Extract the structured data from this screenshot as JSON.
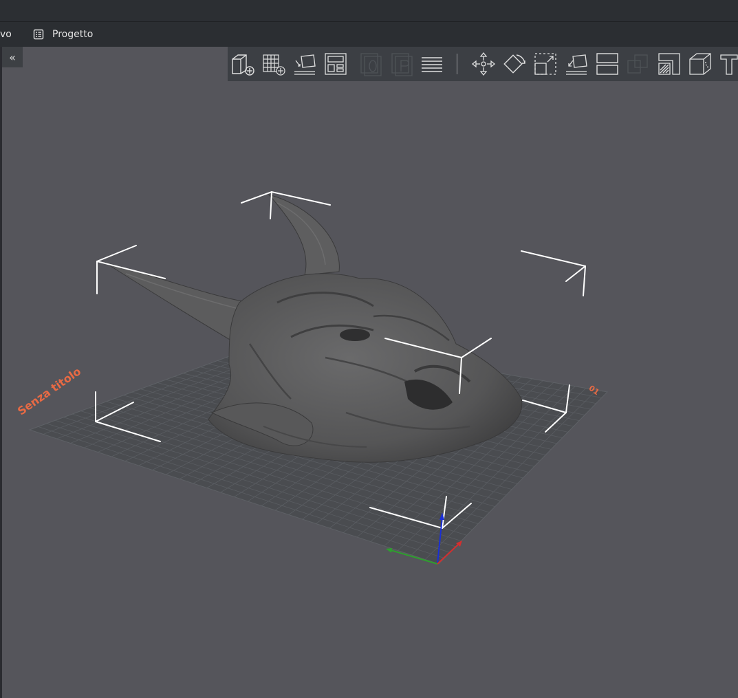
{
  "tabs": {
    "prev_label": "vo",
    "project_label": "Progetto"
  },
  "collapse_glyph": "«",
  "toolbar": {
    "buttons": [
      "add-cube-icon",
      "add-grid-icon",
      "layflat-icon",
      "layout-icon",
      "zero-icon-disabled",
      "p-icon-disabled",
      "layers-icon",
      "move-icon",
      "rotate-icon",
      "scale-icon",
      "place-face-icon",
      "split-icon",
      "merge-icon-disabled",
      "support-paint-icon",
      "seam-cube-icon",
      "text-icon"
    ]
  },
  "plate": {
    "name": "Senza titolo",
    "number": "01"
  },
  "colors": {
    "viewport_bg": "#55555b",
    "plate_label": "#e86a44",
    "axis_x": "#d32f2f",
    "axis_y": "#2e9e2e",
    "axis_z": "#1a2fd6"
  }
}
